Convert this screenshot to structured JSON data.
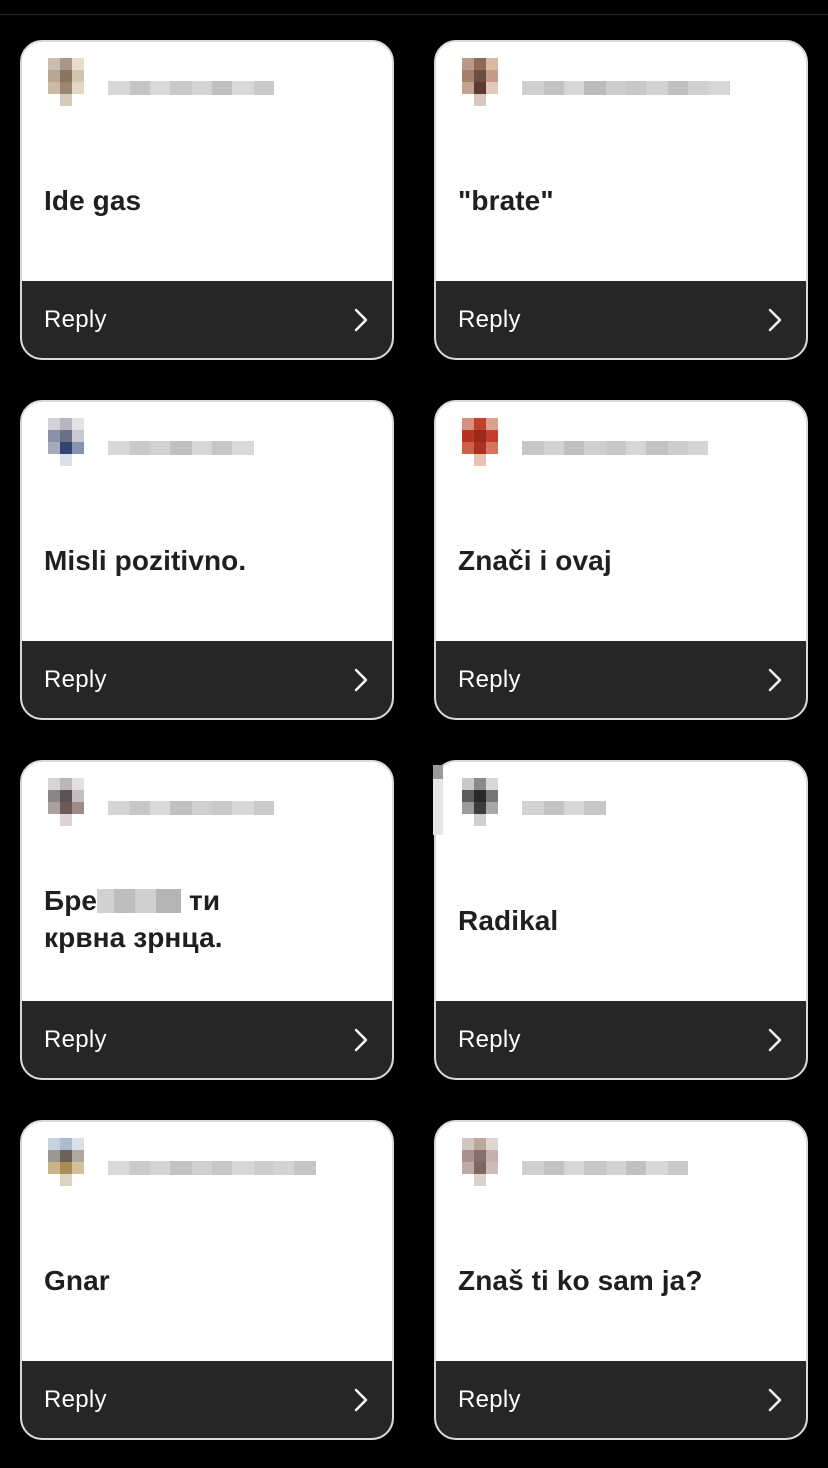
{
  "cards": [
    {
      "message_lines": [
        "Ide gas"
      ],
      "reply_label": "Reply",
      "avatar_colors": [
        "#ffffff",
        "#c8bdb0",
        "#a89886",
        "#e7dccd",
        "#ffffff",
        "#ffffff",
        "#b8a592",
        "#8a7561",
        "#d3c4b0",
        "#ffffff",
        "#ffffff",
        "#c9baa8",
        "#9a8672",
        "#e2d6c6",
        "#ffffff",
        "#ffffff",
        "#ffffff",
        "#d8cabb",
        "#ffffff",
        "#ffffff",
        "#ffffff",
        "#ffffff",
        "#ffffff",
        "#ffffff",
        "#ffffff"
      ],
      "username_colors": [
        "#d6d6d6",
        "#c4c4c4",
        "#d9d9d9",
        "#c9c9c9",
        "#d4d4d4",
        "#bfbfbf",
        "#d9d9d9",
        "#cacaca"
      ]
    },
    {
      "message_lines": [
        "\"brate\""
      ],
      "reply_label": "Reply",
      "avatar_colors": [
        "#ffffff",
        "#b99a86",
        "#8e6a57",
        "#d9bba5",
        "#ffffff",
        "#ffffff",
        "#a57f6a",
        "#6d4d3f",
        "#c59c86",
        "#ffffff",
        "#ffffff",
        "#c2a292",
        "#5b3c33",
        "#e2c9bb",
        "#ffffff",
        "#ffffff",
        "#ffffff",
        "#d8c5bb",
        "#ffffff",
        "#ffffff",
        "#ffffff",
        "#ffffff",
        "#ffffff",
        "#ffffff",
        "#ffffff"
      ],
      "username_colors": [
        "#cfcfcf",
        "#c2c2c2",
        "#d7d7d7",
        "#bcbcbc",
        "#cdcdcd",
        "#c8c8c8",
        "#d3d3d3",
        "#c0c0c0",
        "#cfcfcf",
        "#d6d6d6"
      ]
    },
    {
      "message_lines": [
        "Misli pozitivno."
      ],
      "reply_label": "Reply",
      "avatar_colors": [
        "#ffffff",
        "#d4d2d6",
        "#b8b6c0",
        "#e4e2e6",
        "#ffffff",
        "#ffffff",
        "#8d90a6",
        "#6c7088",
        "#c7c8d2",
        "#ffffff",
        "#ffffff",
        "#a5a9ba",
        "#2f4673",
        "#8891ad",
        "#ffffff",
        "#ffffff",
        "#ffffff",
        "#dedfe6",
        "#ffffff",
        "#ffffff",
        "#ffffff",
        "#ffffff",
        "#ffffff",
        "#ffffff",
        "#ffffff"
      ],
      "username_colors": [
        "#d8d8d8",
        "#c9c9c9",
        "#d2d2d2",
        "#bfbfbf",
        "#d6d6d6",
        "#c6c6c6",
        "#d9d9d9"
      ]
    },
    {
      "message_lines": [
        "Znači i ovaj"
      ],
      "reply_label": "Reply",
      "avatar_colors": [
        "#ffffff",
        "#d89080",
        "#c2412c",
        "#dea090",
        "#ffffff",
        "#ffffff",
        "#b73420",
        "#9c2a18",
        "#c5402c",
        "#ffffff",
        "#ffffff",
        "#cc5f4c",
        "#a8321f",
        "#d8735f",
        "#ffffff",
        "#ffffff",
        "#ffffff",
        "#ecbfb5",
        "#ffffff",
        "#ffffff",
        "#ffffff",
        "#ffffff",
        "#ffffff",
        "#ffffff",
        "#ffffff"
      ],
      "username_colors": [
        "#c6c6c6",
        "#d3d3d3",
        "#bfbfbf",
        "#cfcfcf",
        "#c8c8c8",
        "#d6d6d6",
        "#c2c2c2",
        "#cdcdcd",
        "#d4d4d4"
      ]
    },
    {
      "message_lines": [
        "Бре",
        "ти",
        "крвна зрнца."
      ],
      "reply_label": "Reply",
      "avatar_colors": [
        "#ffffff",
        "#d6d4d4",
        "#b9b6b6",
        "#e2e0e0",
        "#ffffff",
        "#ffffff",
        "#8a8585",
        "#5c5454",
        "#c3bdbd",
        "#ffffff",
        "#ffffff",
        "#a89f9f",
        "#6b5a58",
        "#9d8a87",
        "#ffffff",
        "#ffffff",
        "#ffffff",
        "#dcd3d2",
        "#ffffff",
        "#ffffff",
        "#ffffff",
        "#ffffff",
        "#ffffff",
        "#ffffff",
        "#ffffff"
      ],
      "username_colors": [
        "#d4d4d4",
        "#c6c6c6",
        "#dadada",
        "#c1c1c1",
        "#d0d0d0",
        "#c9c9c9",
        "#d8d8d8",
        "#cbcbcb"
      ]
    },
    {
      "message_lines": [
        "Radikal"
      ],
      "reply_label": "Reply",
      "avatar_colors": [
        "#ffffff",
        "#c9c9c9",
        "#8a8a8a",
        "#d8d8d8",
        "#ffffff",
        "#ffffff",
        "#5c5c5c",
        "#2a2a2a",
        "#767676",
        "#ffffff",
        "#ffffff",
        "#9b9b9b",
        "#3c3c3c",
        "#a8a8a8",
        "#ffffff",
        "#ffffff",
        "#ffffff",
        "#cfcfcf",
        "#ffffff",
        "#ffffff",
        "#ffffff",
        "#ffffff",
        "#ffffff",
        "#ffffff",
        "#ffffff"
      ],
      "username_colors": [
        "#d2d2d2",
        "#c3c3c3",
        "#d8d8d8",
        "#c8c8c8"
      ]
    },
    {
      "message_lines": [
        "Gnar"
      ],
      "reply_label": "Reply",
      "avatar_colors": [
        "#ffffff",
        "#c6d2de",
        "#a9bcd0",
        "#d9e2ea",
        "#ffffff",
        "#ffffff",
        "#9c9690",
        "#6d6256",
        "#b0a89e",
        "#ffffff",
        "#ffffff",
        "#c8b48a",
        "#a88c54",
        "#d2c09a",
        "#ffffff",
        "#ffffff",
        "#ffffff",
        "#dcd2bf",
        "#ffffff",
        "#ffffff",
        "#ffffff",
        "#ffffff",
        "#ffffff",
        "#ffffff",
        "#ffffff"
      ],
      "username_colors": [
        "#dadada",
        "#cbcbcb",
        "#d5d5d5",
        "#c3c3c3",
        "#d1d1d1",
        "#c7c7c7",
        "#d8d8d8",
        "#cdcdcd",
        "#d3d3d3",
        "#c5c5c5"
      ]
    },
    {
      "message_lines": [
        "Znaš ti ko sam ja?"
      ],
      "reply_label": "Reply",
      "avatar_colors": [
        "#ffffff",
        "#d2c6c0",
        "#bba79c",
        "#e0d6d0",
        "#ffffff",
        "#ffffff",
        "#a8918a",
        "#866f68",
        "#c4b1a9",
        "#ffffff",
        "#ffffff",
        "#bfaaa3",
        "#7d6761",
        "#cdbdb6",
        "#ffffff",
        "#ffffff",
        "#ffffff",
        "#ddd0ca",
        "#ffffff",
        "#ffffff",
        "#ffffff",
        "#ffffff",
        "#ffffff",
        "#ffffff",
        "#ffffff"
      ],
      "username_colors": [
        "#cfcfcf",
        "#c2c2c2",
        "#d6d6d6",
        "#c7c7c7",
        "#d3d3d3",
        "#c0c0c0",
        "#d8d8d8",
        "#cacaca"
      ]
    }
  ]
}
